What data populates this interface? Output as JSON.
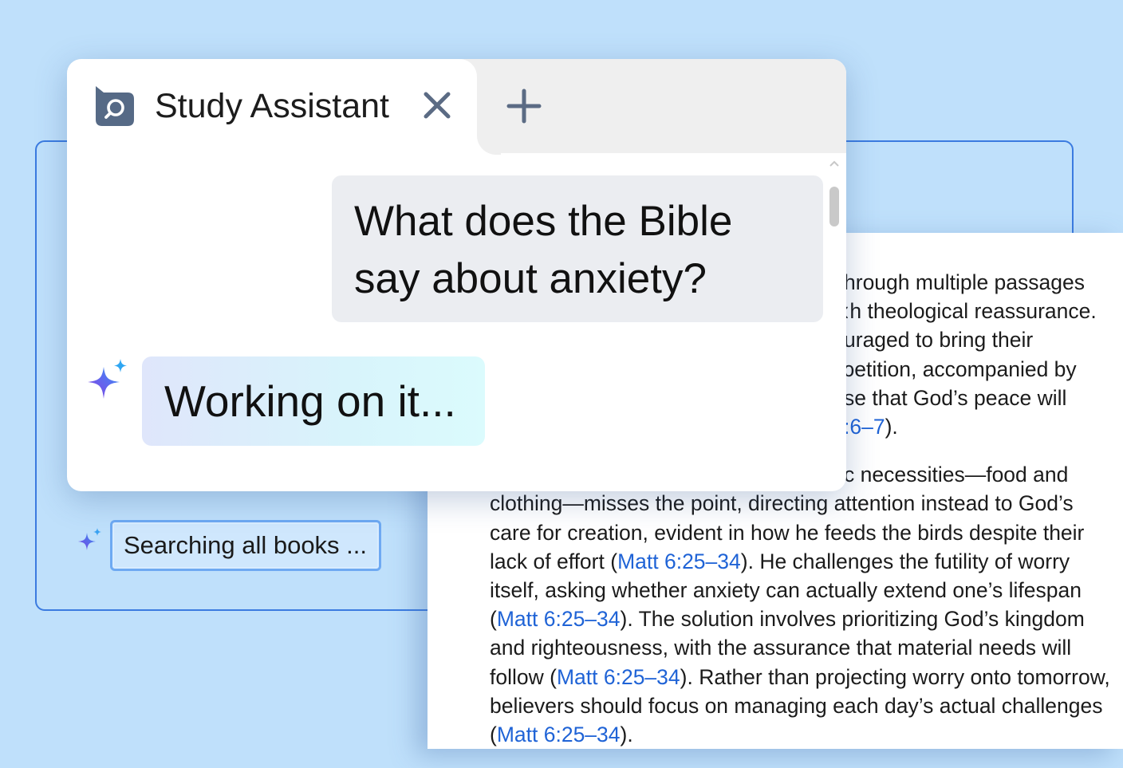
{
  "assistant": {
    "tab_title": "Study Assistant",
    "close_icon": "close-icon",
    "add_tab_icon": "plus-icon",
    "tab_icon": "chat-search-icon",
    "user_message": "What does the Bible say about anxiety?",
    "ai_status": "Working on it...",
    "ai_icon": "sparkle-icon"
  },
  "search": {
    "status_text": "Searching all books ...",
    "icon": "sparkle-icon"
  },
  "document": {
    "para1_lines": [
      "hrough multiple passages",
      "ːh theological reassurance.",
      "uraged to bring their",
      "ɔetition, accompanied by",
      "se that God’s peace will"
    ],
    "para1_ref": ":6–7",
    "para1_end": ").",
    "para2_line1": "c necessities—food and",
    "para2_text1": "clothing—misses the point, directing attention instead to God’s care for creation, evident in how he feeds the birds despite their lack of effort (",
    "para2_ref1": "Matt 6:25–34",
    "para2_text2": "). He challenges the futility of worry itself, asking whether anxiety can actually extend one’s lifespan (",
    "para2_ref2": "Matt 6:25–34",
    "para2_text3": "). The solution involves prioritizing God’s kingdom and righteousness, with the assurance that material needs will follow (",
    "para2_ref3": "Matt 6:25–34",
    "para2_text4": "). Rather than projecting worry onto tomorrow, believers should focus on managing each day’s actual challenges (",
    "para2_ref4": "Matt 6:25–34",
    "para2_text5": ")."
  },
  "colors": {
    "background": "#bfe0fb",
    "link": "#1f63d6",
    "frame": "#3b7be0"
  }
}
